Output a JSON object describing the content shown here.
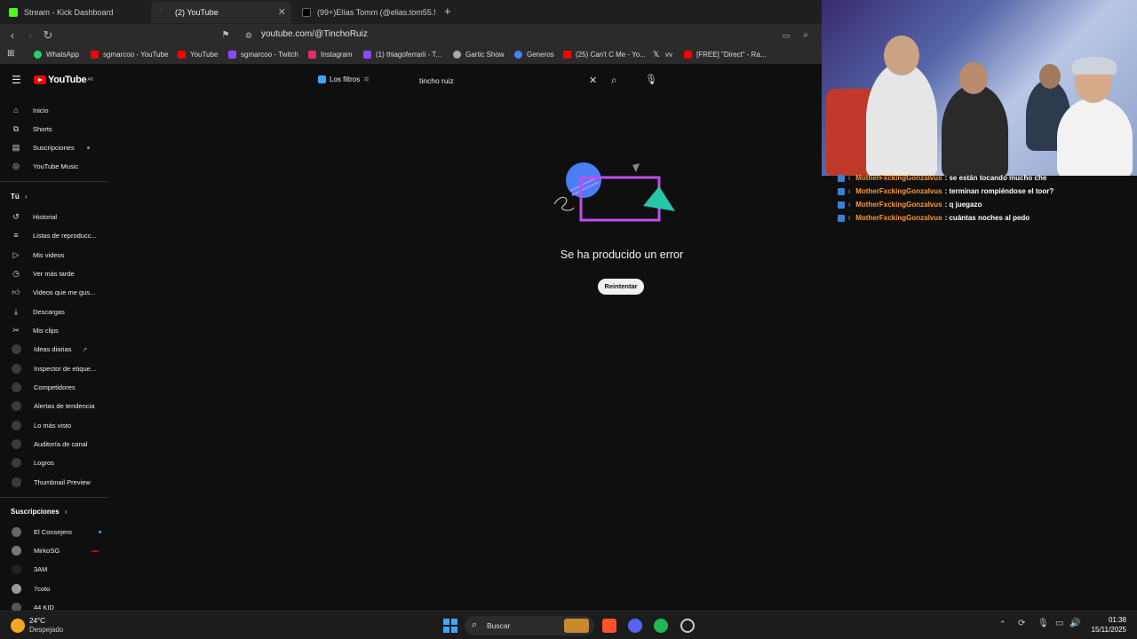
{
  "tabs": [
    {
      "label": "Stream - Kick Dashboard",
      "color": "#53fc18"
    },
    {
      "label": "(2) YouTube",
      "color": "#ff0000"
    },
    {
      "label": "(99+)Elías Tomm (@elias.tom55.5) | T",
      "color": "#ffffff"
    }
  ],
  "address_bar": {
    "url": "youtube.com/@TinchoRuiz"
  },
  "bookmarks": [
    {
      "label": "WhatsApp",
      "color": "#25d366"
    },
    {
      "label": "sgmarcoo - YouTube",
      "color": "#ff0000"
    },
    {
      "label": "YouTube",
      "color": "#ff0000"
    },
    {
      "label": "sgmarcoo - Twitch",
      "color": "#9146ff"
    },
    {
      "label": "Instagram",
      "color": "#e1306c"
    },
    {
      "label": "(1) thiagoferrarii - T...",
      "color": "#9146ff"
    },
    {
      "label": "Gartic Show",
      "color": "#aaaaaa"
    },
    {
      "label": "Generos",
      "color": "#4285f4"
    },
    {
      "label": "(25) Can't C Me - Yo...",
      "color": "#ff0000"
    },
    {
      "label": "vv",
      "color": "#ffffff"
    },
    {
      "label": "[FREE] \"Direct\" - Ra...",
      "color": "#ff0000"
    }
  ],
  "youtube": {
    "logo": "YouTube",
    "logo_country": "AR",
    "filters_label": "Los filtros",
    "search_value": "tincho ruiz",
    "sidebar_main": [
      "Inicio",
      "Shorts",
      "Suscripciones",
      "YouTube Music"
    ],
    "you_heading": "Tú",
    "sidebar_you": [
      "Historial",
      "Listas de reproducc...",
      "Mis videos",
      "Ver más tarde",
      "Videos que me gus...",
      "Descargas",
      "Mis clips"
    ],
    "sidebar_ext": [
      "Ideas diarias",
      "Inspector de etique...",
      "Competidores",
      "Alertas de tendencia",
      "Lo más visto",
      "Auditoría de canal",
      "Logros",
      "Thumbnail Preview"
    ],
    "subs_heading": "Suscripciones",
    "subscriptions": [
      "El Consejero",
      "MirkoSG",
      "3AM",
      "7coto",
      "44 KID"
    ],
    "error_message": "Se ha producido un error",
    "retry_label": "Reintentar"
  },
  "chat": [
    {
      "user": "MotherFxckingGonzalvus",
      "message": ": se están tocando mucho che"
    },
    {
      "user": "MotherFxckingGonzalvus",
      "message": ": terminan rompiéndose el toor?"
    },
    {
      "user": "MotherFxckingGonzalvus",
      "message": ": q juegazo"
    },
    {
      "user": "MotherFxckingGonzalvus",
      "message": ": cuántas noches al pedo"
    }
  ],
  "taskbar": {
    "weather_temp": "24°C",
    "weather_desc": "Despejado",
    "search_placeholder": "Buscar",
    "time": "01:38",
    "date": "15/11/2025"
  }
}
